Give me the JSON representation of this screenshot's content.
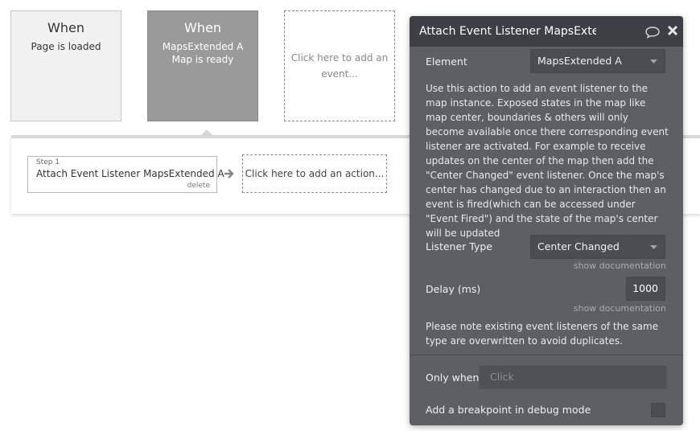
{
  "events": [
    {
      "title": "When",
      "subtitle": "Page is loaded"
    },
    {
      "title": "When",
      "subtitle": "MapsExtended A Map is ready"
    },
    {
      "add_label": "Click here to add an event..."
    }
  ],
  "workflow": {
    "step_number": "Step 1",
    "step_name": "Attach Event Listener MapsExtended A",
    "delete_label": "delete",
    "add_action_label": "Click here to add an action..."
  },
  "panel": {
    "title": "Attach Event Listener MapsExtended A",
    "element_label": "Element",
    "element_value": "MapsExtended A",
    "description": "Use this action to add an event listener to the map instance. Exposed states in the map like map center, boundaries & others will only become available once there corresponding event listener are activated. For example to receive updates on the center of the map then add the \"Center Changed\" event listener. Once the map's center has changed due to an interaction then an event is fired(which can be accessed under \"Event Fired\") and the state of the map's center will be updated",
    "listener_type_label": "Listener Type",
    "listener_type_value": "Center Changed",
    "show_documentation": "show documentation",
    "delay_label": "Delay (ms)",
    "delay_value": "1000",
    "note": "Please note existing event listeners of the same type are overwritten to avoid duplicates.",
    "only_when_label": "Only when",
    "only_when_placeholder": "Click",
    "breakpoint_label": "Add a breakpoint in debug mode"
  },
  "colors": {
    "panel_bg": "#5c5f63",
    "panel_header": "#3c3f43",
    "selected_event": "#9a9a9a"
  }
}
